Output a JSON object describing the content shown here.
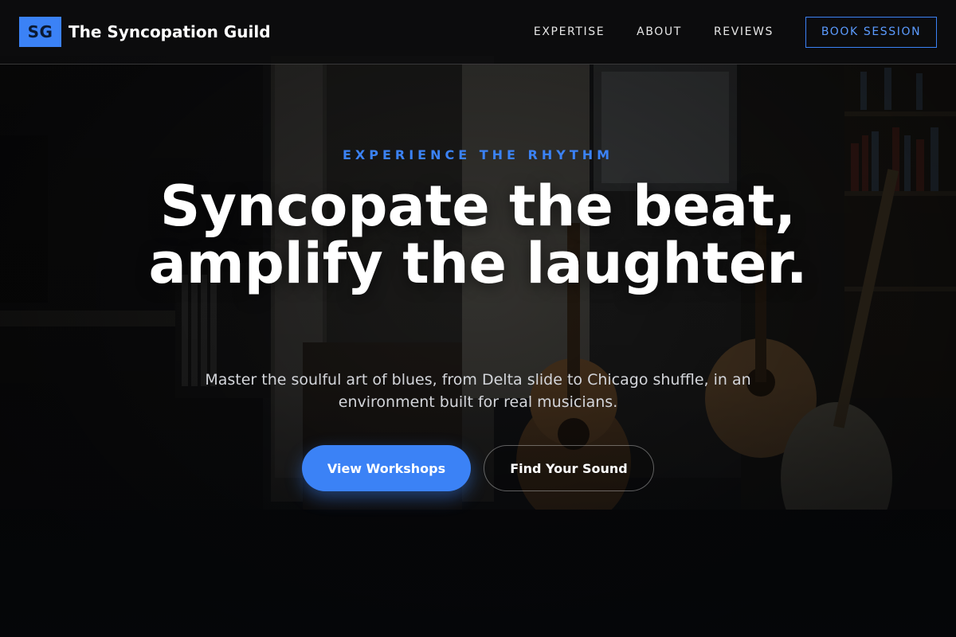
{
  "brand": {
    "mark": "SG",
    "name": "The Syncopation Guild"
  },
  "nav": {
    "links": [
      "EXPERTISE",
      "ABOUT",
      "REVIEWS"
    ],
    "cta": "BOOK SESSION"
  },
  "hero": {
    "eyebrow": "EXPERIENCE THE RHYTHM",
    "headline": "Syncopate the beat, amplify the laughter.",
    "subline": "Master the soulful art of blues, from Delta slide to Chicago shuffle, in an environment built for real musicians.",
    "primary_cta": "View Workshops",
    "secondary_cta": "Find Your Sound"
  },
  "colors": {
    "accent": "#3b82f6",
    "background": "#0c0d10"
  },
  "icons": {
    "background_image": "music-studio-room-image"
  }
}
